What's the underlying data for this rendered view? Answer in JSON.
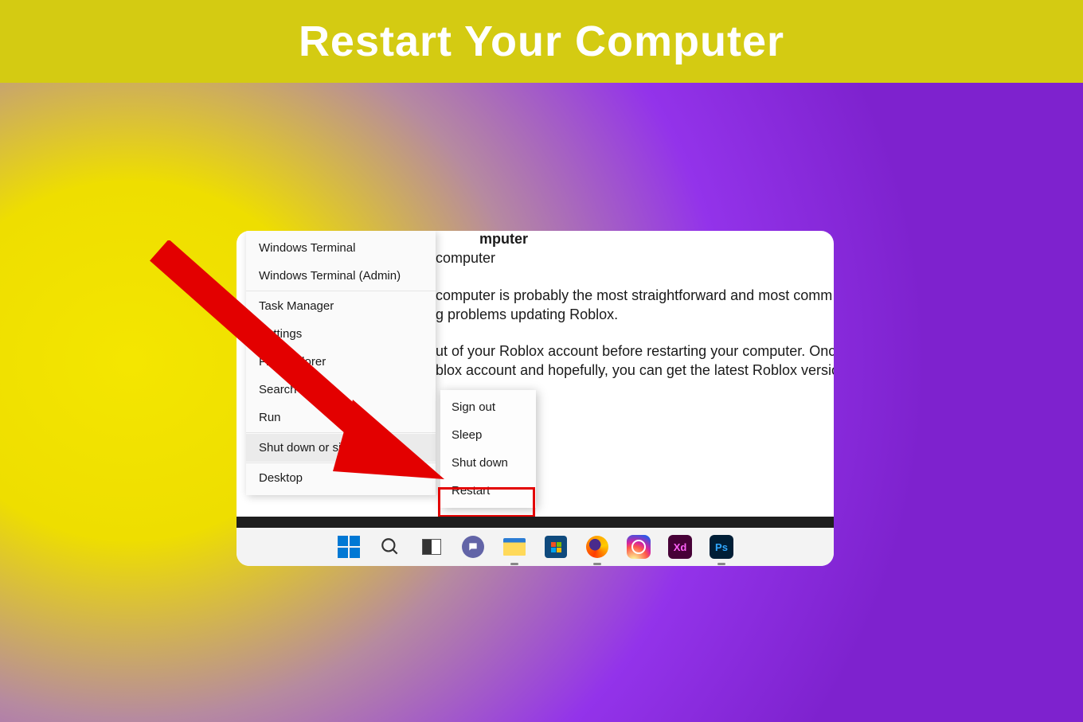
{
  "header": {
    "title": "Restart Your Computer"
  },
  "backgroundText": {
    "frag1": "mputer",
    "frag2": "computer",
    "para1a": "computer is probably the most straightforward and most comm",
    "para1b": "g problems updating Roblox.",
    "para2a": "ut of your Roblox account before restarting your computer. Onc",
    "para2b": "blox account and hopefully, you can get the latest Roblox versio"
  },
  "contextMenu": {
    "items": [
      "Windows Terminal",
      "Windows Terminal (Admin)",
      "Task Manager",
      "Settings",
      "File Explorer",
      "Search",
      "Run",
      "Shut down or sign out",
      "Desktop"
    ],
    "hoveredIndex": 7
  },
  "submenu": {
    "items": [
      "Sign out",
      "Sleep",
      "Shut down",
      "Restart"
    ],
    "highlightedIndex": 3
  },
  "taskbar": {
    "icons": [
      {
        "name": "start",
        "open": false
      },
      {
        "name": "search",
        "open": false
      },
      {
        "name": "taskview",
        "open": false
      },
      {
        "name": "teams-chat",
        "open": false
      },
      {
        "name": "file-explorer",
        "open": true
      },
      {
        "name": "microsoft-store",
        "open": false
      },
      {
        "name": "firefox",
        "open": true
      },
      {
        "name": "instagram",
        "open": false
      },
      {
        "name": "adobe-xd",
        "open": false
      },
      {
        "name": "adobe-photoshop",
        "open": true
      }
    ],
    "xdLabel": "Xd",
    "psLabel": "Ps"
  },
  "colors": {
    "highlight": "#e30000",
    "banner": "#d4cb12"
  }
}
